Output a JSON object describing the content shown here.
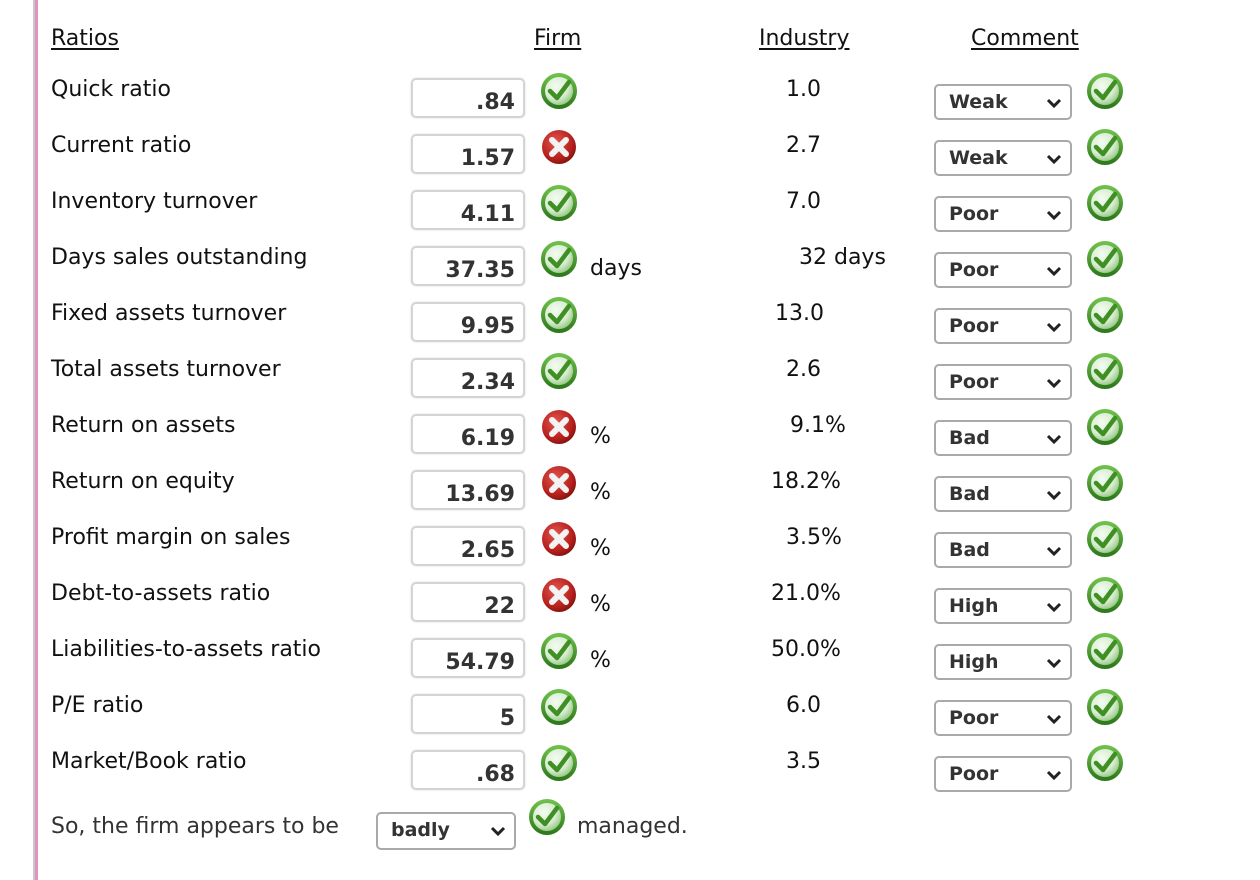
{
  "headers": {
    "ratios": "Ratios",
    "firm": "Firm",
    "industry": "Industry",
    "comment": "Comment"
  },
  "rows": [
    {
      "label": "Quick ratio",
      "firm_value": ".84",
      "firm_status": "correct",
      "unit": "",
      "industry": "1.0",
      "comment": "Weak",
      "comment_status": "correct"
    },
    {
      "label": "Current ratio",
      "firm_value": "1.57",
      "firm_status": "incorrect",
      "unit": "",
      "industry": "2.7",
      "comment": "Weak",
      "comment_status": "correct"
    },
    {
      "label": "Inventory turnover",
      "firm_value": "4.11",
      "firm_status": "correct",
      "unit": "",
      "industry": "7.0",
      "comment": "Poor",
      "comment_status": "correct"
    },
    {
      "label": "Days sales outstanding",
      "firm_value": "37.35",
      "firm_status": "correct",
      "unit": "days",
      "industry": "32 days",
      "comment": "Poor",
      "comment_status": "correct"
    },
    {
      "label": "Fixed assets turnover",
      "firm_value": "9.95",
      "firm_status": "correct",
      "unit": "",
      "industry": "13.0",
      "comment": "Poor",
      "comment_status": "correct"
    },
    {
      "label": "Total assets turnover",
      "firm_value": "2.34",
      "firm_status": "correct",
      "unit": "",
      "industry": "2.6",
      "comment": "Poor",
      "comment_status": "correct"
    },
    {
      "label": "Return on assets",
      "firm_value": "6.19",
      "firm_status": "incorrect",
      "unit": "%",
      "industry": "9.1%",
      "comment": "Bad",
      "comment_status": "correct"
    },
    {
      "label": "Return on equity",
      "firm_value": "13.69",
      "firm_status": "incorrect",
      "unit": "%",
      "industry": "18.2%",
      "comment": "Bad",
      "comment_status": "correct"
    },
    {
      "label": "Profit margin on sales",
      "firm_value": "2.65",
      "firm_status": "incorrect",
      "unit": "%",
      "industry": "3.5%",
      "comment": "Bad",
      "comment_status": "correct"
    },
    {
      "label": "Debt-to-assets ratio",
      "firm_value": "22",
      "firm_status": "incorrect",
      "unit": "%",
      "industry": "21.0%",
      "comment": "High",
      "comment_status": "correct"
    },
    {
      "label": "Liabilities-to-assets ratio",
      "firm_value": "54.79",
      "firm_status": "correct",
      "unit": "%",
      "industry": "50.0%",
      "comment": "High",
      "comment_status": "correct"
    },
    {
      "label": "P/E ratio",
      "firm_value": "5",
      "firm_status": "correct",
      "unit": "",
      "industry": "6.0",
      "comment": "Poor",
      "comment_status": "correct"
    },
    {
      "label": "Market/Book ratio",
      "firm_value": ".68",
      "firm_status": "correct",
      "unit": "",
      "industry": "3.5",
      "comment": "Poor",
      "comment_status": "correct"
    }
  ],
  "summary": {
    "prefix": "So, the firm appears to be",
    "selected": "badly",
    "status": "correct",
    "suffix": "managed."
  },
  "icons": {
    "correct": "check-circle-icon",
    "incorrect": "x-circle-icon",
    "dropdown": "chevron-down-icon"
  },
  "colors": {
    "correct_green": "#4a9a2c",
    "incorrect_red": "#b8201c",
    "left_border_pink": "#e591bf"
  }
}
